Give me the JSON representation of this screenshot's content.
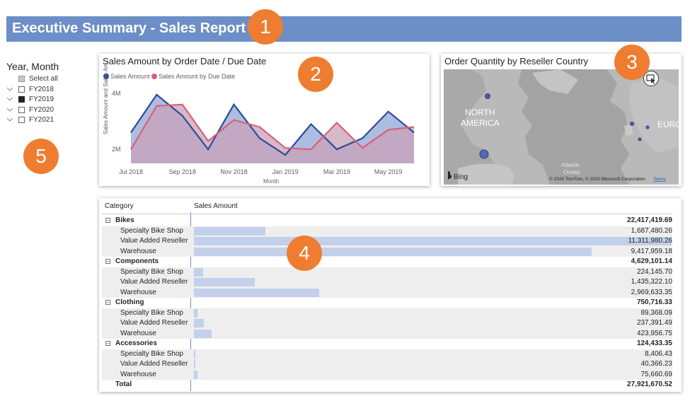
{
  "title": "Executive Summary - Sales Report",
  "callouts": [
    "1",
    "2",
    "3",
    "4",
    "5"
  ],
  "slicer": {
    "title": "Year, Month",
    "items": [
      {
        "label": "Select all",
        "state": "partial",
        "expandable": false
      },
      {
        "label": "FY2018",
        "state": "unchecked",
        "expandable": true
      },
      {
        "label": "FY2019",
        "state": "checked",
        "expandable": true
      },
      {
        "label": "FY2020",
        "state": "unchecked",
        "expandable": true
      },
      {
        "label": "FY2021",
        "state": "unchecked",
        "expandable": true
      }
    ]
  },
  "line_chart": {
    "title": "Sales Amount by Order Date / Due Date",
    "legend": [
      "Sales Amount",
      "Sales Amount by Due Date"
    ],
    "ylabel": "Sales Amount and Sales Am...",
    "xlabel": "Month",
    "y_ticks": [
      "4M",
      "2M"
    ],
    "x_ticks": [
      "Jul 2018",
      "Sep 2018",
      "Nov 2018",
      "Jan 2019",
      "Mar 2019",
      "May 2019"
    ]
  },
  "map": {
    "title": "Order Quantity by Reseller Country",
    "labels": [
      "NORTH",
      "AMERICA",
      "EURO",
      "Atlantic",
      "Ocean"
    ],
    "attribution": "© 2020 TomTom, © 2020 Microsoft Corporation",
    "terms": "Terms",
    "bing": "Bing"
  },
  "table": {
    "headers": [
      "Category",
      "Sales Amount"
    ],
    "groups": [
      {
        "name": "Bikes",
        "total": "22,417,419.69",
        "rows": [
          {
            "name": "Specialty Bike Shop",
            "value": "1,687,480.26"
          },
          {
            "name": "Value Added Reseller",
            "value": "11,311,980.26"
          },
          {
            "name": "Warehouse",
            "value": "9,417,959.18"
          }
        ]
      },
      {
        "name": "Components",
        "total": "4,629,101.14",
        "rows": [
          {
            "name": "Specialty Bike Shop",
            "value": "224,145.70"
          },
          {
            "name": "Value Added Reseller",
            "value": "1,435,322.10"
          },
          {
            "name": "Warehouse",
            "value": "2,969,633.35"
          }
        ]
      },
      {
        "name": "Clothing",
        "total": "750,716.33",
        "rows": [
          {
            "name": "Specialty Bike Shop",
            "value": "89,368.09"
          },
          {
            "name": "Value Added Reseller",
            "value": "237,391.49"
          },
          {
            "name": "Warehouse",
            "value": "423,956.75"
          }
        ]
      },
      {
        "name": "Accessories",
        "total": "124,433.35",
        "rows": [
          {
            "name": "Specialty Bike Shop",
            "value": "8,406.43"
          },
          {
            "name": "Value Added Reseller",
            "value": "40,366.23"
          },
          {
            "name": "Warehouse",
            "value": "75,660.69"
          }
        ]
      }
    ],
    "total_label": "Total",
    "grand_total": "27,921,670.52"
  },
  "chart_data": {
    "type": "area",
    "title": "Sales Amount by Order Date / Due Date",
    "xlabel": "Month",
    "ylabel": "Sales Amount and Sales Am...",
    "ylim": [
      1500000,
      4200000
    ],
    "x": [
      "2018-07",
      "2018-08",
      "2018-09",
      "2018-10",
      "2018-11",
      "2018-12",
      "2019-01",
      "2019-02",
      "2019-03",
      "2019-04",
      "2019-05",
      "2019-06"
    ],
    "series": [
      {
        "name": "Sales Amount",
        "color": "#2f4b9b",
        "fill": "#9fb1dc",
        "values": [
          2600000,
          3950000,
          3200000,
          2000000,
          3600000,
          2400000,
          1800000,
          2900000,
          2000000,
          2400000,
          3350000,
          2600000
        ]
      },
      {
        "name": "Sales Amount by Due Date",
        "color": "#d9607a",
        "fill": "#c9a2b7",
        "values": [
          2000000,
          3550000,
          3600000,
          2300000,
          3050000,
          2800000,
          2050000,
          2000000,
          2950000,
          2050000,
          2700000,
          2800000
        ]
      }
    ],
    "grid": false,
    "legend": "top-left"
  },
  "colors": {
    "banner": "#6b8fc6",
    "callout": "#ee7d31",
    "bar": "#c3d0ea",
    "series1": "#2f4b9b",
    "series2": "#d9607a"
  }
}
